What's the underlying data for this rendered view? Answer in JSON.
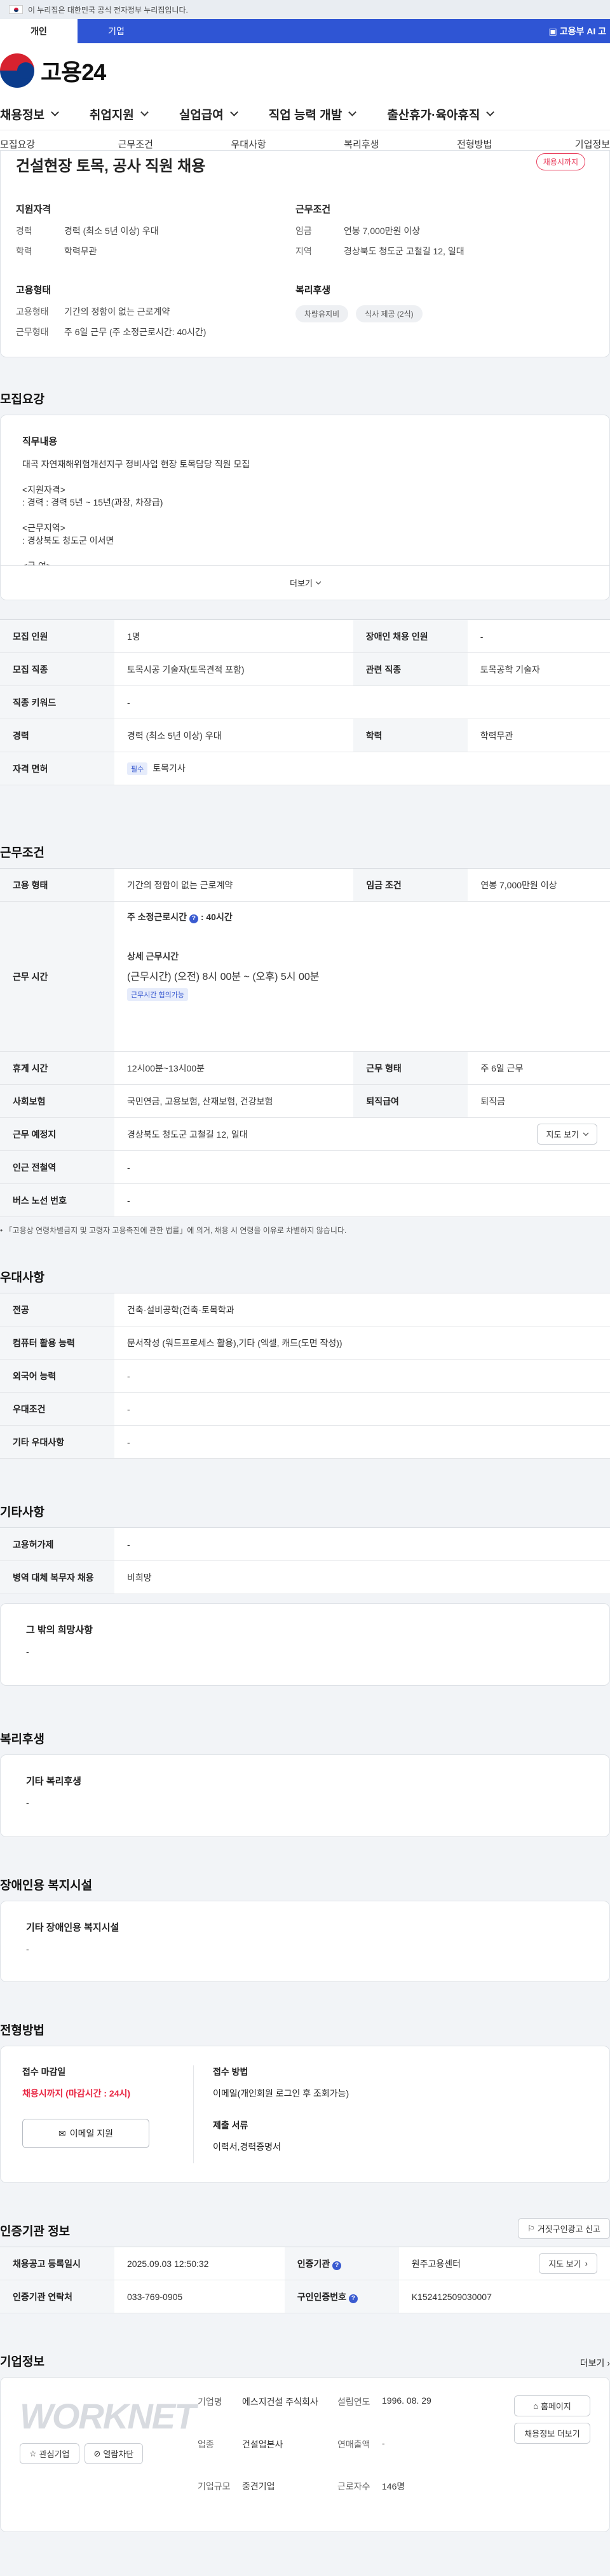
{
  "banner": {
    "text": "이 누리집은 대한민국 공식 전자정부 누리집입니다."
  },
  "tabs": [
    {
      "label": "개인"
    },
    {
      "label": "기업"
    }
  ],
  "ai_link": "고용부 AI 고",
  "logo_text": "고용24",
  "nav": [
    "채용정보",
    "취업지원",
    "실업급여",
    "직업 능력 개발",
    "출산휴가·육아휴직"
  ],
  "subnav": [
    "모집요강",
    "근무조건",
    "우대사항",
    "복리후생",
    "전형방법",
    "기업정보"
  ],
  "job": {
    "title": "건설현장 토목, 공사 직원 채용",
    "status": "채용시까지",
    "qual_title": "지원자격",
    "qual": [
      {
        "k": "경력",
        "v": "경력 (최소 5년 이상) 우대"
      },
      {
        "k": "학력",
        "v": "학력무관"
      }
    ],
    "cond_title": "근무조건",
    "cond": [
      {
        "k": "임금",
        "v": "연봉 7,000만원 이상"
      },
      {
        "k": "지역",
        "v": "경상북도 청도군 고철길 12, 일대"
      }
    ],
    "emp_title": "고용형태",
    "emp": [
      {
        "k": "고용형태",
        "v": "기간의 정함이 없는 근로계약"
      },
      {
        "k": "근무형태",
        "v": "주 6일 근무 (주 소정근로시간: 40시간)"
      }
    ],
    "welfare_title": "복리후생",
    "welfare": [
      "차량유지비",
      "식사 제공 (2식)"
    ]
  },
  "recruit": {
    "title": "모집요강",
    "desc_title": "직무내용",
    "desc": "대곡 자연재해위험개선지구 정비사업 현장 토목담당 직원 모집\n\n<지원자격>\n: 경력 : 경력 5년 ~ 15년(과장, 차장급)\n\n<근무지역>\n: 경상북도 청도군 이서면\n\n<급 여>",
    "more": "더보기",
    "rows": [
      [
        "모집 인원",
        "1명",
        "장애인 채용 인원",
        "-"
      ],
      [
        "모집 직종",
        "토목시공 기술자(토목견적 포함)",
        "관련 직종",
        "토목공학 기술자"
      ],
      [
        "직종 키워드",
        "-"
      ],
      [
        "경력",
        "경력 (최소 5년 이상) 우대",
        "학력",
        "학력무관"
      ]
    ],
    "license_label": "자격 면허",
    "license_tag": "필수",
    "license_value": "토목기사"
  },
  "work": {
    "title": "근무조건",
    "r1": [
      "고용 형태",
      "기간의 정함이 없는 근로계약",
      "임금 조건",
      "연봉 7,000만원 이상"
    ],
    "hours_label": "근무 시간",
    "hours_std": "주 소정근로시간",
    "hours_std_val": ": 40시간",
    "hours_detail_title": "상세 근무시간",
    "hours_detail": "(근무시간) (오전) 8시 00분 ~ (오후) 5시 00분",
    "hours_tag": "근무시간 협의가능",
    "r3": [
      "휴게 시간",
      "12시00분~13시00분",
      "근무 형태",
      "주 6일 근무"
    ],
    "r4": [
      "사회보험",
      "국민연금, 고용보험, 산재보험, 건강보험",
      "퇴직급여",
      "퇴직금"
    ],
    "place_label": "근무 예정지",
    "place": "경상북도 청도군 고철길 12, 일대",
    "map_btn": "지도 보기",
    "r6": [
      "인근 전철역",
      "-"
    ],
    "r7": [
      "버스 노선 번호",
      "-"
    ],
    "note": "「고용상 연령차별금지 및 고령자 고용촉진에 관한 법률」에 의거, 채용 시 연령을 이유로 차별하지 않습니다."
  },
  "pref": {
    "title": "우대사항",
    "rows": [
      [
        "전공",
        "건축·설비공학(건축·토목학과"
      ],
      [
        "컴퓨터 활용 능력",
        "문서작성 (워드프로세스 활용),기타 (엑셀, 캐드(도면 작성))"
      ],
      [
        "외국어 능력",
        "-"
      ],
      [
        "우대조건",
        "-"
      ],
      [
        "기타 우대사항",
        "-"
      ]
    ]
  },
  "etc": {
    "title": "기타사항",
    "rows": [
      [
        "고용허가제",
        "-"
      ],
      [
        "병역 대체 복무자 채용",
        "비희망"
      ]
    ],
    "other_title": "그 밖의 희망사항",
    "other_value": "-"
  },
  "benefit": {
    "title": "복리후생",
    "box_title": "기타 복리후생",
    "box_value": "-"
  },
  "disabled": {
    "title": "장애인용 복지시설",
    "box_title": "기타 장애인용 복지시설",
    "box_value": "-"
  },
  "process": {
    "title": "전형방법",
    "deadline_title": "접수 마감일",
    "deadline": "채용시까지 (마감시간 : 24시)",
    "apply_btn": "이메일 지원",
    "method_title": "접수 방법",
    "method": "이메일(개인회원 로그인 후 조회가능)",
    "docs_title": "제출 서류",
    "docs": "이력서,경력증명서"
  },
  "cert": {
    "title": "인증기관 정보",
    "report_btn": "거짓구인광고 신고",
    "r1": [
      "채용공고 등록일시",
      "2025.09.03 12:50:32",
      "인증기관",
      "원주고용센터"
    ],
    "r2": [
      "인증기관 연락처",
      "033-769-0905",
      "구인인증번호",
      "K152412509030007"
    ]
  },
  "company": {
    "title": "기업정보",
    "more": "더보기",
    "logo": "WORKNET",
    "fav_btn": "관심기업",
    "block_btn": "열람차단",
    "name_k": "기업명",
    "name": "에스지건설 주식회사",
    "ind_k": "업종",
    "ind": "건설업본사",
    "size_k": "기업규모",
    "size": "중견기업",
    "est_k": "설립연도",
    "est": "1996. 08. 29",
    "sales_k": "연매출액",
    "sales": "-",
    "emp_k": "근로자수",
    "emp": "146명",
    "home_btn": "홈페이지",
    "jobs_btn": "채용정보 더보기"
  }
}
